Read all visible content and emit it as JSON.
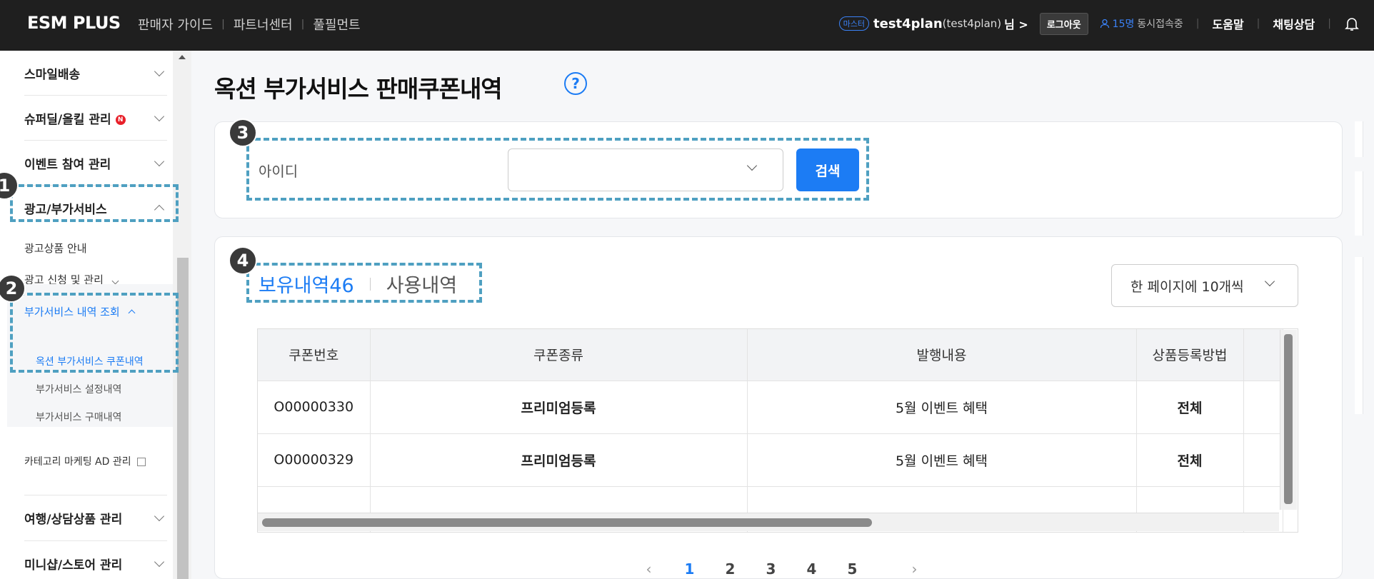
{
  "topbar": {
    "logo": "ESM PLUS",
    "nav": [
      "판매자 가이드",
      "파트너센터",
      "풀필먼트"
    ],
    "master_badge": "마스터",
    "user_name": "test4plan",
    "user_id": "(test4plan)",
    "user_suffix": "님 >",
    "logout": "로그아웃",
    "concurrent_count": "15명",
    "concurrent_label": "동시접속중",
    "help": "도움말",
    "chat": "채팅상담"
  },
  "sidebar": {
    "sections": [
      {
        "label": "스마일배송"
      },
      {
        "label": "슈퍼딜/올킬 관리",
        "badge": "N"
      },
      {
        "label": "이벤트 참여 관리"
      },
      {
        "label": "광고/부가서비스"
      }
    ],
    "ad_product_guide": "광고상품 안내",
    "ad_apply_manage": "광고 신청 및 관리",
    "addon_history": "부가서비스 내역 조회",
    "sub_items": [
      "옥션 부가서비스 쿠폰내역",
      "부가서비스 설정내역",
      "부가서비스 구매내역"
    ],
    "category_marketing": "카테고리 마케팅 AD 관리",
    "bottom_sections": [
      {
        "label": "여행/상담상품 관리"
      },
      {
        "label": "미니샵/스토어 관리"
      }
    ]
  },
  "page": {
    "title": "옥션 부가서비스 판매쿠폰내역",
    "help_icon": "?"
  },
  "search": {
    "label": "아이디",
    "select_value": "",
    "button": "검색"
  },
  "list": {
    "tab_active": "보유내역46",
    "tab_inactive": "사용내역",
    "per_page": "한 페이지에 10개씩",
    "columns": [
      "쿠폰번호",
      "쿠폰종류",
      "발행내용",
      "상품등록방법",
      ""
    ],
    "rows": [
      [
        "O00000330",
        "프리미엄등록",
        "5월 이벤트 혜택",
        "전체",
        ""
      ],
      [
        "O00000329",
        "프리미엄등록",
        "5월 이벤트 혜택",
        "전체",
        ""
      ],
      [
        "",
        "",
        "",
        "",
        ""
      ]
    ]
  },
  "pagination": {
    "prev": "‹",
    "pages": [
      "1",
      "2",
      "3",
      "4",
      "5"
    ],
    "current": "1",
    "next": "›"
  },
  "annotations": {
    "markers": [
      "1",
      "2",
      "3",
      "4"
    ],
    "color": "#4fa0c1"
  },
  "colors": {
    "accent": "#1c7cf4",
    "topbar_bg": "#1f1f1f",
    "new_badge": "#e8202a"
  }
}
